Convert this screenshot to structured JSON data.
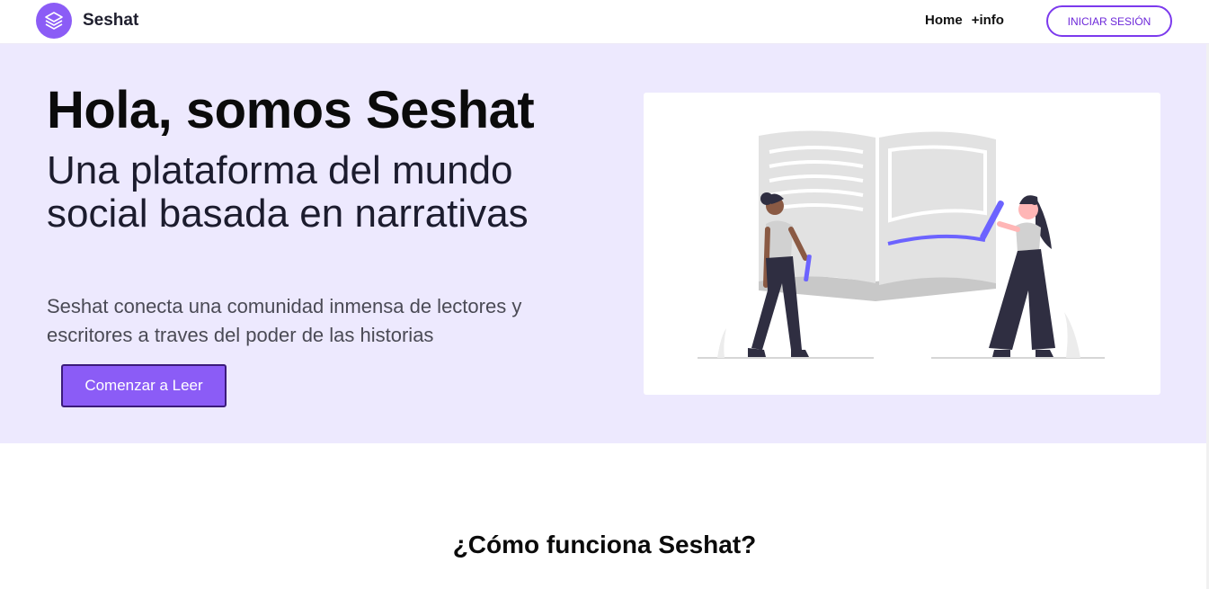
{
  "navbar": {
    "brand": "Seshat",
    "links": [
      "Home",
      "+info"
    ],
    "login_label": "INICIAR SESIÓN"
  },
  "hero": {
    "title": "Hola, somos Seshat",
    "subtitle": "Una plataforma del mundo social basada en narrativas",
    "description": "Seshat conecta una comunidad inmensa de lectores y escritores a traves del poder de las historias",
    "cta_label": "Comenzar a Leer"
  },
  "section": {
    "title": "¿Cómo funciona Seshat?"
  },
  "icons": {
    "logo": "layers-icon"
  },
  "colors": {
    "accent": "#8b5cf6",
    "hero_background": "#ede9fe",
    "dark": "#2f2e41"
  }
}
